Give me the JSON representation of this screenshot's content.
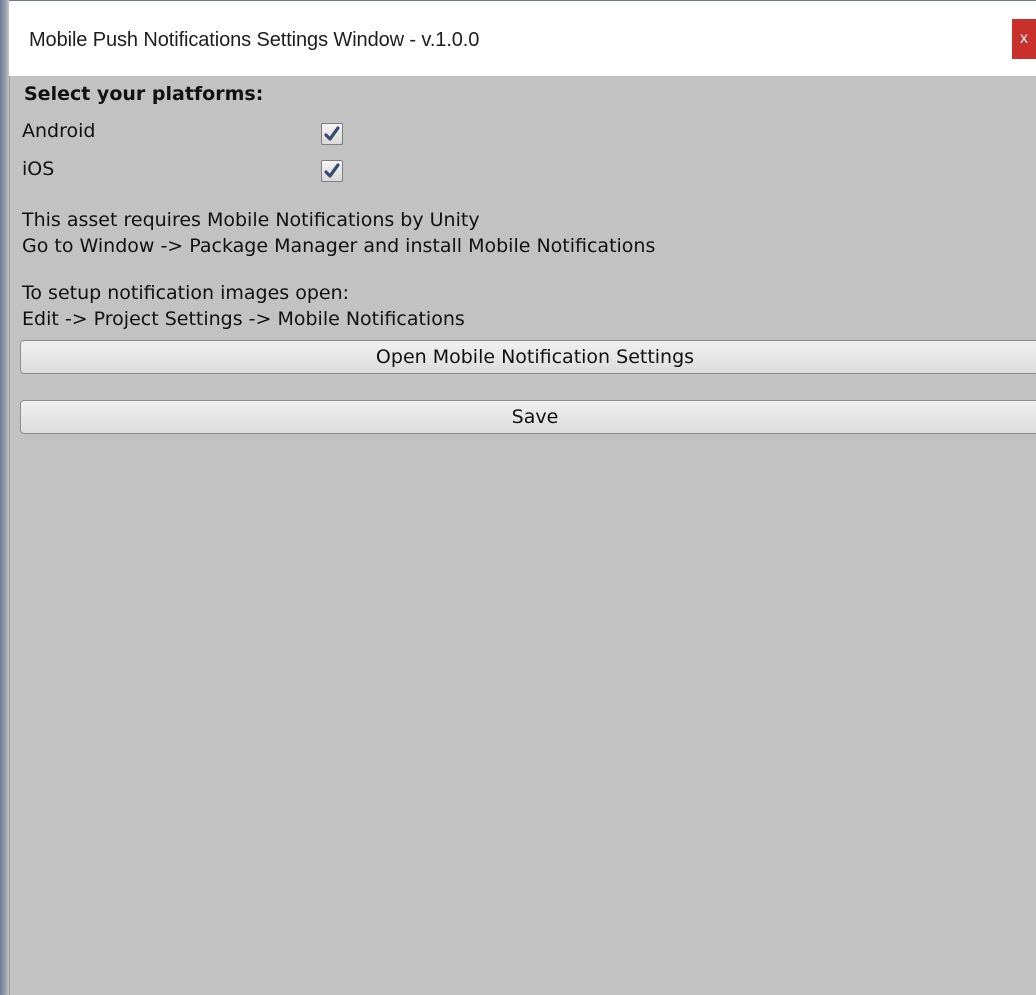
{
  "window": {
    "title": "Mobile Push Notifications Settings Window - v.1.0.0",
    "close_label": "x"
  },
  "platforms": {
    "heading": "Select your platforms:",
    "items": [
      {
        "label": "Android",
        "checked": true
      },
      {
        "label": "iOS",
        "checked": true
      }
    ]
  },
  "info": {
    "requirement_line1": "This asset requires Mobile Notifications by Unity",
    "requirement_line2": "Go to Window -> Package Manager and install Mobile Notifications",
    "images_line1": "To setup notification images open:",
    "images_line2": "Edit -> Project Settings -> Mobile Notifications"
  },
  "buttons": {
    "open_settings_label": "Open Mobile Notification Settings",
    "save_label": "Save"
  },
  "colors": {
    "background": "#c2c2c2",
    "titlebar": "#ffffff",
    "close_button": "#c9302c",
    "checkmark": "#3a4a70"
  },
  "icons": {
    "checkmark": "checkmark-icon",
    "close": "close-icon"
  }
}
